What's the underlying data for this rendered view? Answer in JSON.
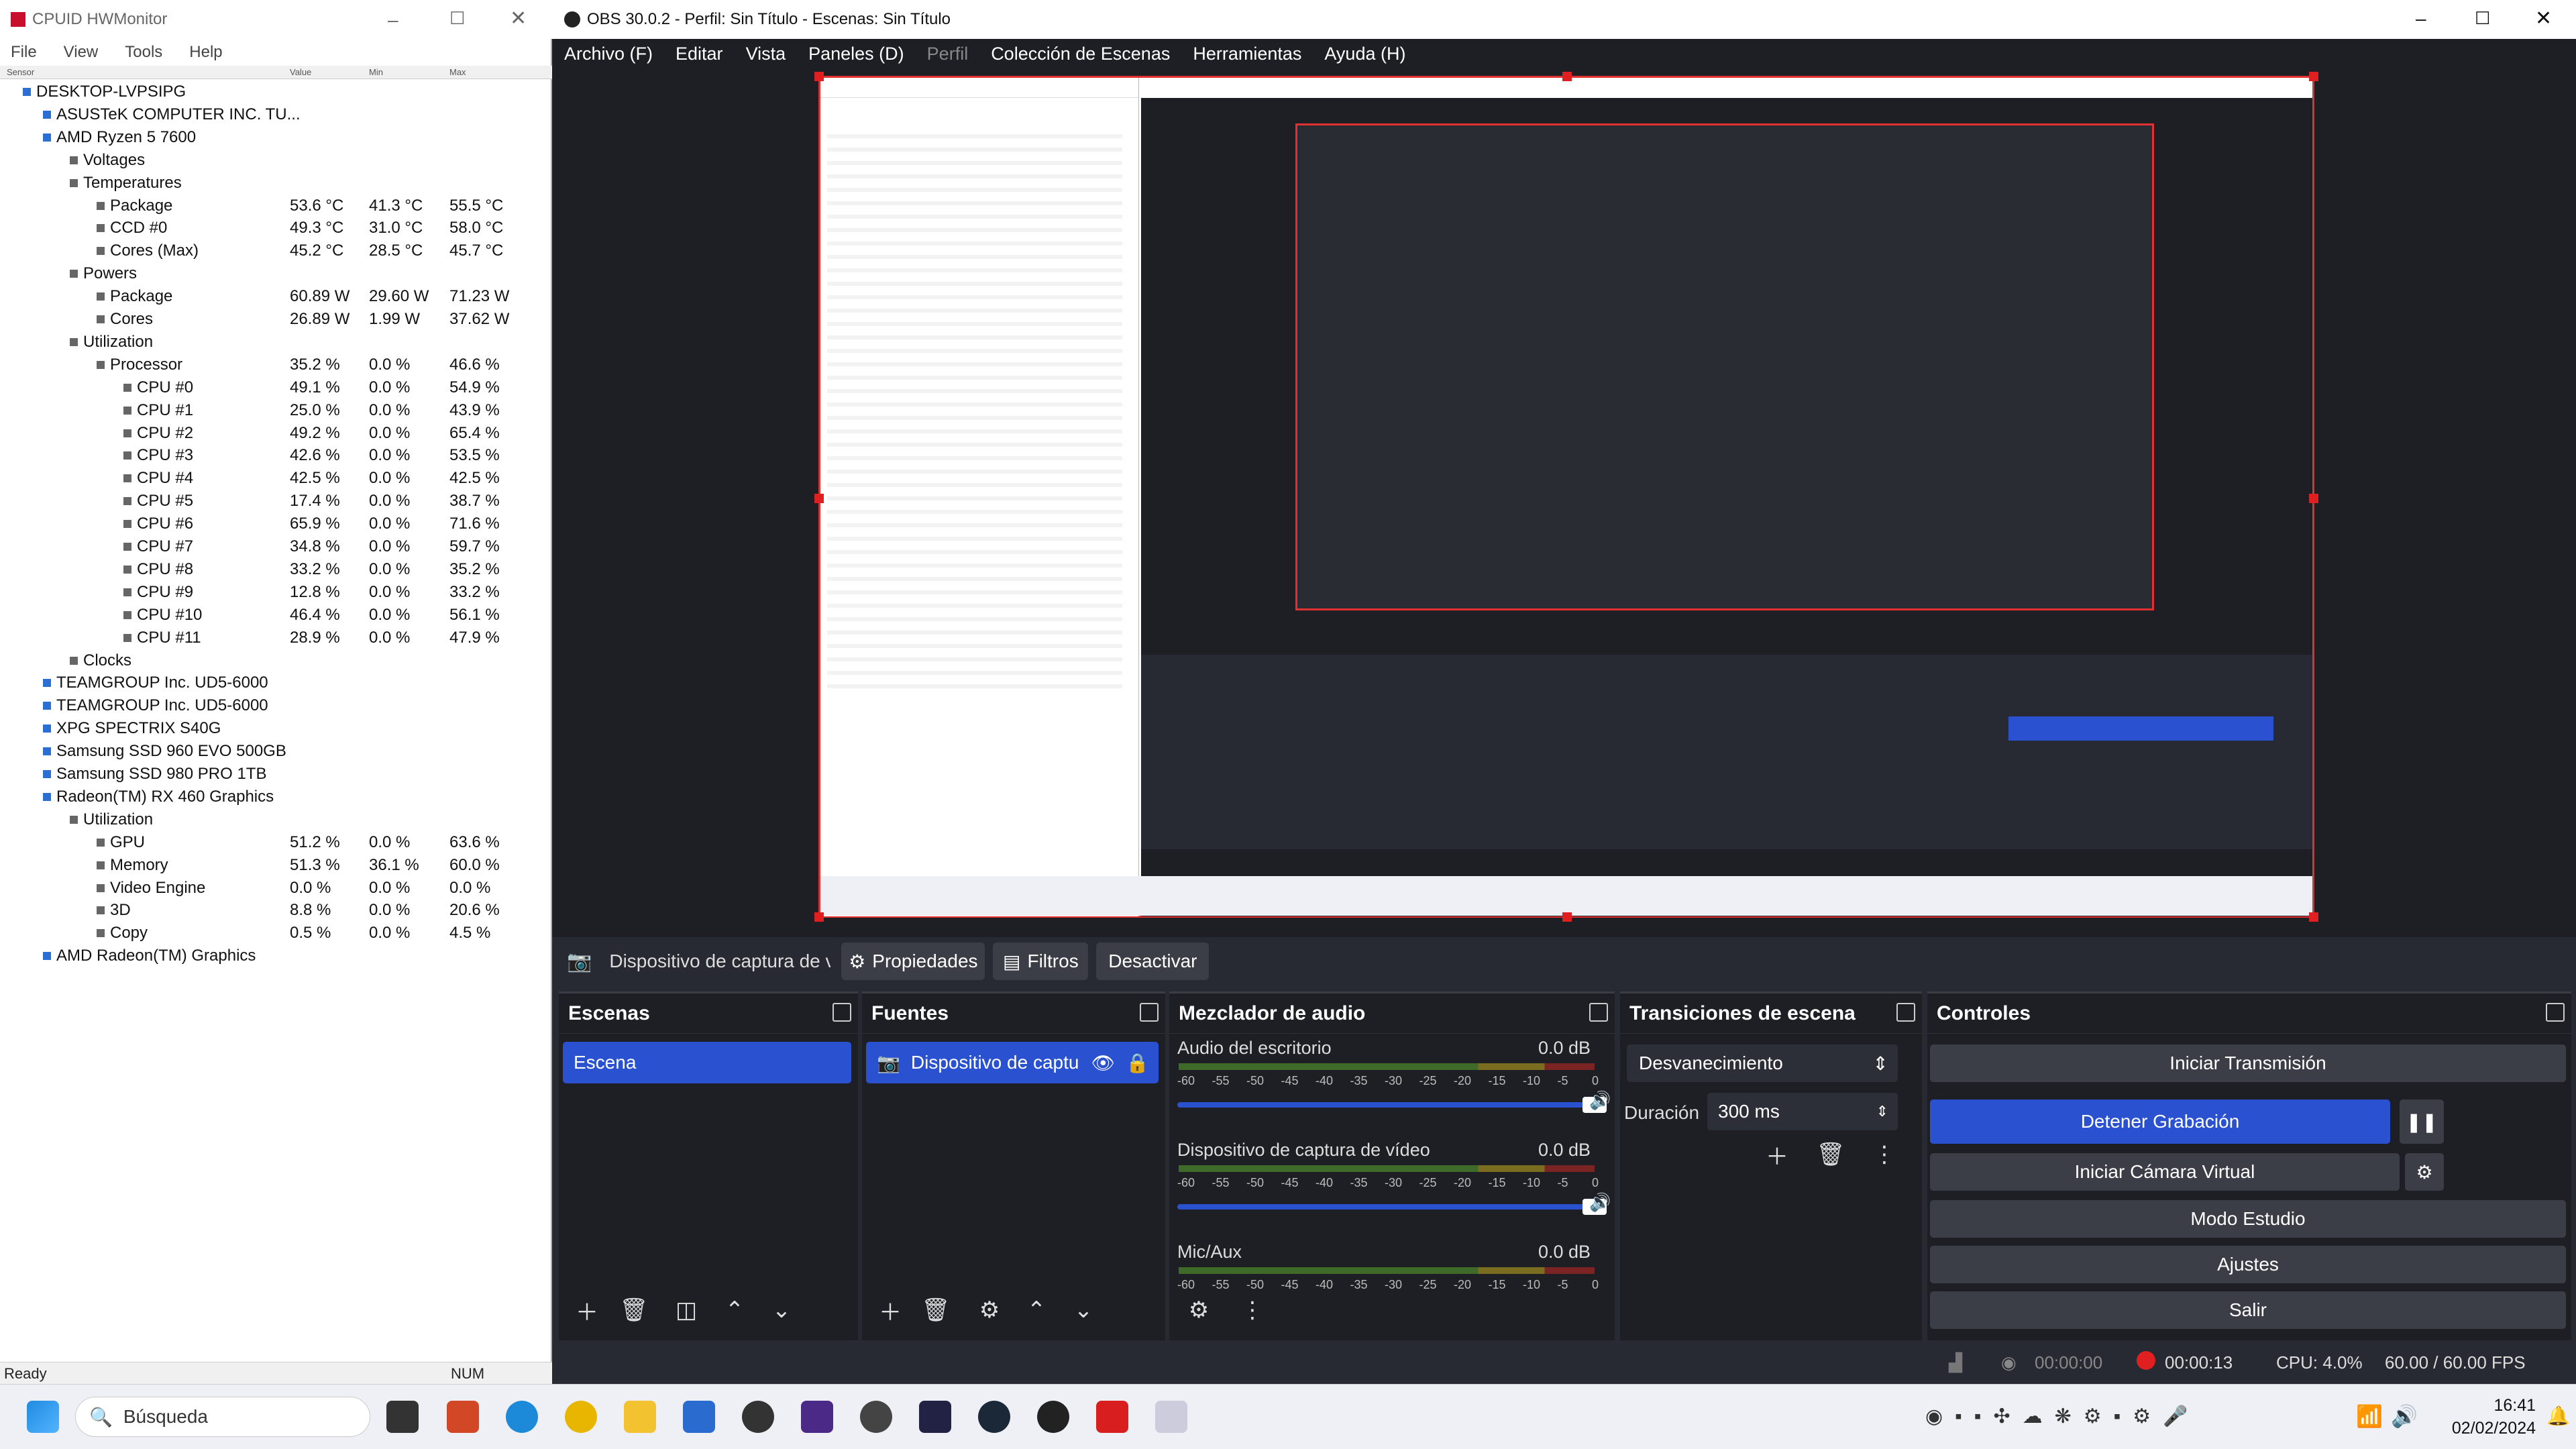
{
  "hwmonitor": {
    "title": "CPUID HWMonitor",
    "menu": [
      "File",
      "View",
      "Tools",
      "Help"
    ],
    "columns": [
      "Sensor",
      "Value",
      "Min",
      "Max"
    ],
    "status": "Ready",
    "num": "NUM",
    "tree": [
      {
        "label": "DESKTOP-LVPSIPG",
        "lvl": 0,
        "v": [
          "",
          "",
          ""
        ]
      },
      {
        "label": "ASUSTeK COMPUTER INC. TU...",
        "lvl": 1,
        "v": [
          "",
          "",
          ""
        ]
      },
      {
        "label": "AMD Ryzen 5 7600",
        "lvl": 1,
        "v": [
          "",
          "",
          ""
        ]
      },
      {
        "label": "Voltages",
        "lvl": 2,
        "v": [
          "",
          "",
          ""
        ]
      },
      {
        "label": "Temperatures",
        "lvl": 2,
        "v": [
          "",
          "",
          ""
        ]
      },
      {
        "label": "Package",
        "lvl": 3,
        "v": [
          "53.6 °C",
          "41.3 °C",
          "55.5 °C"
        ]
      },
      {
        "label": "CCD #0",
        "lvl": 3,
        "v": [
          "49.3 °C",
          "31.0 °C",
          "58.0 °C"
        ]
      },
      {
        "label": "Cores (Max)",
        "lvl": 3,
        "v": [
          "45.2 °C",
          "28.5 °C",
          "45.7 °C"
        ]
      },
      {
        "label": "Powers",
        "lvl": 2,
        "v": [
          "",
          "",
          ""
        ]
      },
      {
        "label": "Package",
        "lvl": 3,
        "v": [
          "60.89 W",
          "29.60 W",
          "71.23 W"
        ]
      },
      {
        "label": "Cores",
        "lvl": 3,
        "v": [
          "26.89 W",
          "1.99 W",
          "37.62 W"
        ]
      },
      {
        "label": "Utilization",
        "lvl": 2,
        "v": [
          "",
          "",
          ""
        ]
      },
      {
        "label": "Processor",
        "lvl": 3,
        "v": [
          "35.2 %",
          "0.0 %",
          "46.6 %"
        ]
      },
      {
        "label": "CPU #0",
        "lvl": 4,
        "v": [
          "49.1 %",
          "0.0 %",
          "54.9 %"
        ]
      },
      {
        "label": "CPU #1",
        "lvl": 4,
        "v": [
          "25.0 %",
          "0.0 %",
          "43.9 %"
        ]
      },
      {
        "label": "CPU #2",
        "lvl": 4,
        "v": [
          "49.2 %",
          "0.0 %",
          "65.4 %"
        ]
      },
      {
        "label": "CPU #3",
        "lvl": 4,
        "v": [
          "42.6 %",
          "0.0 %",
          "53.5 %"
        ]
      },
      {
        "label": "CPU #4",
        "lvl": 4,
        "v": [
          "42.5 %",
          "0.0 %",
          "42.5 %"
        ]
      },
      {
        "label": "CPU #5",
        "lvl": 4,
        "v": [
          "17.4 %",
          "0.0 %",
          "38.7 %"
        ]
      },
      {
        "label": "CPU #6",
        "lvl": 4,
        "v": [
          "65.9 %",
          "0.0 %",
          "71.6 %"
        ]
      },
      {
        "label": "CPU #7",
        "lvl": 4,
        "v": [
          "34.8 %",
          "0.0 %",
          "59.7 %"
        ]
      },
      {
        "label": "CPU #8",
        "lvl": 4,
        "v": [
          "33.2 %",
          "0.0 %",
          "35.2 %"
        ]
      },
      {
        "label": "CPU #9",
        "lvl": 4,
        "v": [
          "12.8 %",
          "0.0 %",
          "33.2 %"
        ]
      },
      {
        "label": "CPU #10",
        "lvl": 4,
        "v": [
          "46.4 %",
          "0.0 %",
          "56.1 %"
        ]
      },
      {
        "label": "CPU #11",
        "lvl": 4,
        "v": [
          "28.9 %",
          "0.0 %",
          "47.9 %"
        ]
      },
      {
        "label": "Clocks",
        "lvl": 2,
        "v": [
          "",
          "",
          ""
        ]
      },
      {
        "label": "TEAMGROUP Inc. UD5-6000",
        "lvl": 1,
        "v": [
          "",
          "",
          ""
        ]
      },
      {
        "label": "TEAMGROUP Inc. UD5-6000",
        "lvl": 1,
        "v": [
          "",
          "",
          ""
        ]
      },
      {
        "label": "XPG SPECTRIX S40G",
        "lvl": 1,
        "v": [
          "",
          "",
          ""
        ]
      },
      {
        "label": "Samsung SSD 960 EVO 500GB",
        "lvl": 1,
        "v": [
          "",
          "",
          ""
        ]
      },
      {
        "label": "Samsung SSD 980 PRO 1TB",
        "lvl": 1,
        "v": [
          "",
          "",
          ""
        ]
      },
      {
        "label": "Radeon(TM) RX 460 Graphics",
        "lvl": 1,
        "v": [
          "",
          "",
          ""
        ]
      },
      {
        "label": "Utilization",
        "lvl": 2,
        "v": [
          "",
          "",
          ""
        ]
      },
      {
        "label": "GPU",
        "lvl": 3,
        "v": [
          "51.2 %",
          "0.0 %",
          "63.6 %"
        ]
      },
      {
        "label": "Memory",
        "lvl": 3,
        "v": [
          "51.3 %",
          "36.1 %",
          "60.0 %"
        ]
      },
      {
        "label": "Video Engine",
        "lvl": 3,
        "v": [
          "0.0 %",
          "0.0 %",
          "0.0 %"
        ]
      },
      {
        "label": "3D",
        "lvl": 3,
        "v": [
          "8.8 %",
          "0.0 %",
          "20.6 %"
        ]
      },
      {
        "label": "Copy",
        "lvl": 3,
        "v": [
          "0.5 %",
          "0.0 %",
          "4.5 %"
        ]
      },
      {
        "label": "AMD Radeon(TM) Graphics",
        "lvl": 1,
        "v": [
          "",
          "",
          ""
        ]
      }
    ]
  },
  "obs": {
    "title": "OBS 30.0.2 - Perfil: Sin Título - Escenas: Sin Título",
    "menu": [
      "Archivo (F)",
      "Editar",
      "Vista",
      "Paneles (D)",
      "Perfil",
      "Colección de Escenas",
      "Herramientas",
      "Ayuda (H)"
    ],
    "context": {
      "source": "Dispositivo de captura de v",
      "props": "Propiedades",
      "filters": "Filtros",
      "deactivate": "Desactivar"
    },
    "scenes": {
      "title": "Escenas",
      "items": [
        "Escena"
      ]
    },
    "sources": {
      "title": "Fuentes",
      "items": [
        "Dispositivo de captu"
      ]
    },
    "mixer": {
      "title": "Mezclador de audio",
      "channels": [
        {
          "name": "Audio del escritorio",
          "db": "0.0 dB"
        },
        {
          "name": "Dispositivo de captura de vídeo",
          "db": "0.0 dB"
        },
        {
          "name": "Mic/Aux",
          "db": "0.0 dB"
        }
      ],
      "scale": [
        "-60",
        "-55",
        "-50",
        "-45",
        "-40",
        "-35",
        "-30",
        "-25",
        "-20",
        "-15",
        "-10",
        "-5",
        "0"
      ]
    },
    "transitions": {
      "title": "Transiciones de escena",
      "type": "Desvanecimiento",
      "duration_label": "Duración",
      "duration": "300 ms"
    },
    "controls": {
      "title": "Controles",
      "start_stream": "Iniciar Transmisión",
      "stop_rec": "Detener Grabación",
      "virtual_cam": "Iniciar Cámara Virtual",
      "studio": "Modo Estudio",
      "settings": "Ajustes",
      "exit": "Salir"
    },
    "status": {
      "stream_time": "00:00:00",
      "rec_time": "00:00:13",
      "cpu": "CPU: 4.0%",
      "fps": "60.00 / 60.00 FPS"
    }
  },
  "taskbar": {
    "search": "Búsqueda",
    "time": "16:41",
    "date": "02/02/2024"
  },
  "colors": {
    "accent": "#2a52d0",
    "rec": "#e02020",
    "panel": "#1e1f24",
    "bg": "#272a33"
  }
}
